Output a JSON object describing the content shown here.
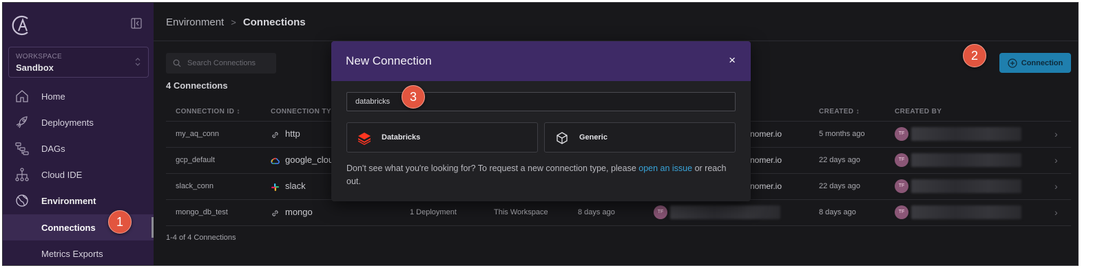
{
  "sidebar": {
    "workspace_label": "WORKSPACE",
    "workspace_name": "Sandbox",
    "items": [
      {
        "label": "Home",
        "icon": "home-icon"
      },
      {
        "label": "Deployments",
        "icon": "rocket-icon"
      },
      {
        "label": "DAGs",
        "icon": "dag-icon"
      },
      {
        "label": "Cloud IDE",
        "icon": "cloud-ide-icon"
      },
      {
        "label": "Environment",
        "icon": "globe-icon"
      },
      {
        "label": "Connections"
      },
      {
        "label": "Metrics Exports"
      }
    ]
  },
  "breadcrumb": {
    "parent": "Environment",
    "sep": ">",
    "current": "Connections"
  },
  "search": {
    "placeholder": "Search Connections"
  },
  "list": {
    "title": "4 Connections",
    "add_label": "Connection",
    "footer": "1-4 of 4 Connections",
    "headers": {
      "id": "CONNECTION ID ↕",
      "type": "CONNECTION TYPE",
      "created": "CREATED ↕",
      "created_by": "CREATED BY"
    },
    "rows": [
      {
        "id": "my_aq_conn",
        "type": "http",
        "icon": "link-icon",
        "deployments": "",
        "scope": "",
        "updated": "",
        "updater_domain": "nomer.io",
        "created": "5 months ago",
        "creator_initials": "TF"
      },
      {
        "id": "gcp_default",
        "type": "google_cloud",
        "icon": "google-cloud-icon",
        "deployments": "",
        "scope": "",
        "updated": "",
        "updater_domain": "nomer.io",
        "created": "22 days ago",
        "creator_initials": "TF"
      },
      {
        "id": "slack_conn",
        "type": "slack",
        "icon": "slack-icon",
        "deployments": "",
        "scope": "",
        "updated": "",
        "updater_domain": "nomer.io",
        "created": "22 days ago",
        "creator_initials": "TF"
      },
      {
        "id": "mongo_db_test",
        "type": "mongo",
        "icon": "link-icon",
        "deployments": "1 Deployment",
        "scope": "This Workspace",
        "updated": "8 days ago",
        "updater_initials": "TF",
        "created": "8 days ago",
        "creator_initials": "TF"
      }
    ]
  },
  "modal": {
    "title": "New Connection",
    "close": "×",
    "filter_value": "databricks",
    "options": [
      {
        "label": "Databricks",
        "icon": "databricks-icon"
      },
      {
        "label": "Generic",
        "icon": "cube-icon"
      }
    ],
    "help_before": "Don't see what you're looking for? To request a new connection type, please ",
    "help_link": "open an issue",
    "help_after": " or reach out."
  },
  "callouts": [
    "1",
    "2",
    "3"
  ],
  "colors": {
    "sidebar": "#2a1c3e",
    "modal_header": "#3e2a66",
    "primary": "#1f7fae",
    "callout": "#e2553f",
    "link": "#38a3d8"
  }
}
